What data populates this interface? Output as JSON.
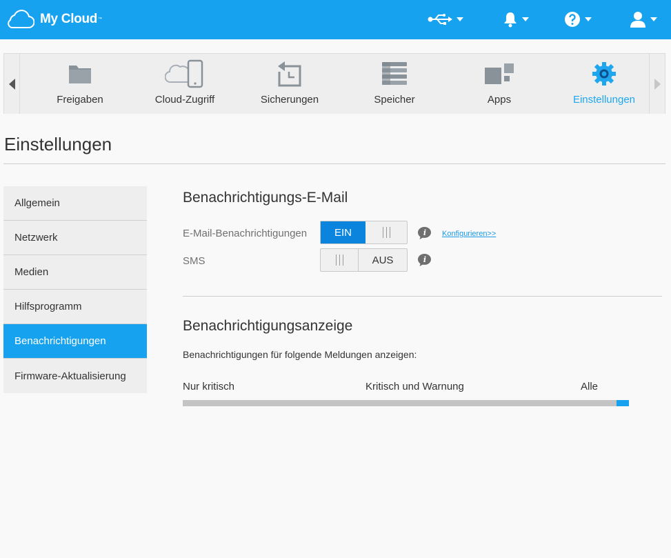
{
  "app": {
    "title": "My Cloud",
    "trademark": "™"
  },
  "header": {
    "icons": [
      "usb-icon",
      "bell-icon",
      "help-icon",
      "user-icon"
    ]
  },
  "nav": {
    "items": [
      {
        "label": "Freigaben",
        "icon": "folder-icon"
      },
      {
        "label": "Cloud-Zugriff",
        "icon": "cloud-device-icon"
      },
      {
        "label": "Sicherungen",
        "icon": "backup-icon"
      },
      {
        "label": "Speicher",
        "icon": "storage-icon"
      },
      {
        "label": "Apps",
        "icon": "apps-icon"
      },
      {
        "label": "Einstellungen",
        "icon": "gear-icon",
        "active": true
      }
    ]
  },
  "page": {
    "title": "Einstellungen"
  },
  "sidebar": {
    "items": [
      {
        "label": "Allgemein"
      },
      {
        "label": "Netzwerk"
      },
      {
        "label": "Medien"
      },
      {
        "label": "Hilfsprogramm"
      },
      {
        "label": "Benachrichtigungen",
        "active": true
      },
      {
        "label": "Firmware-Aktualisierung"
      }
    ]
  },
  "email_section": {
    "title": "Benachrichtigungs-E-Mail",
    "email_label": "E-Mail-Benachrichtigungen",
    "email_toggle": "EIN",
    "sms_label": "SMS",
    "sms_toggle": "AUS",
    "configure_link": "Konfigurieren>>"
  },
  "display_section": {
    "title": "Benachrichtigungsanzeige",
    "description": "Benachrichtigungen für folgende Meldungen anzeigen:",
    "slider": {
      "labels": [
        "Nur kritisch",
        "Kritisch und Warnung",
        "Alle"
      ],
      "selected": "Alle"
    }
  },
  "colors": {
    "brand": "#17a2f0",
    "toggle_on": "#0a84dc",
    "link": "#1a9ae8",
    "active_nav": "#1ea7ef"
  }
}
